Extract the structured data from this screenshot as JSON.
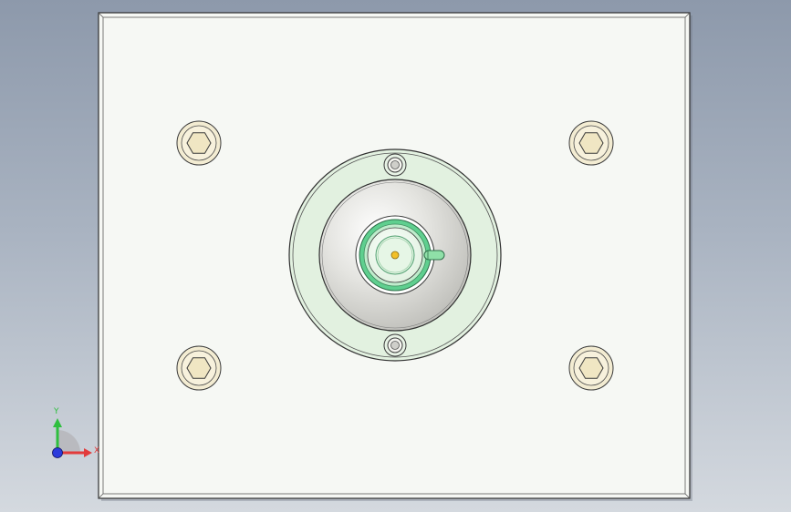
{
  "viewport": {
    "background_top": "#8d99ab",
    "background_bottom": "#d4d9df"
  },
  "plate": {
    "face_color": "#f6f8f4",
    "edge_color": "#3a3a3a"
  },
  "bolts": [
    {
      "name": "bolt-top-left",
      "icon": "hex-socket-screw-icon"
    },
    {
      "name": "bolt-top-right",
      "icon": "hex-socket-screw-icon"
    },
    {
      "name": "bolt-bottom-left",
      "icon": "hex-socket-screw-icon"
    },
    {
      "name": "bolt-bottom-right",
      "icon": "hex-socket-screw-icon"
    }
  ],
  "colors": {
    "bolt_fill": "#f3ecd2",
    "flange_fill": "#e2f1e0",
    "cone_fill": "#d7d7d2",
    "connector_ring": "#5fcf8f",
    "center_pin": "#f2c029"
  },
  "triad": {
    "x_label": "X",
    "y_label": "Y",
    "x_color": "#e23b3b",
    "y_color": "#2fbf3f",
    "z_color": "#2b3bdc"
  }
}
